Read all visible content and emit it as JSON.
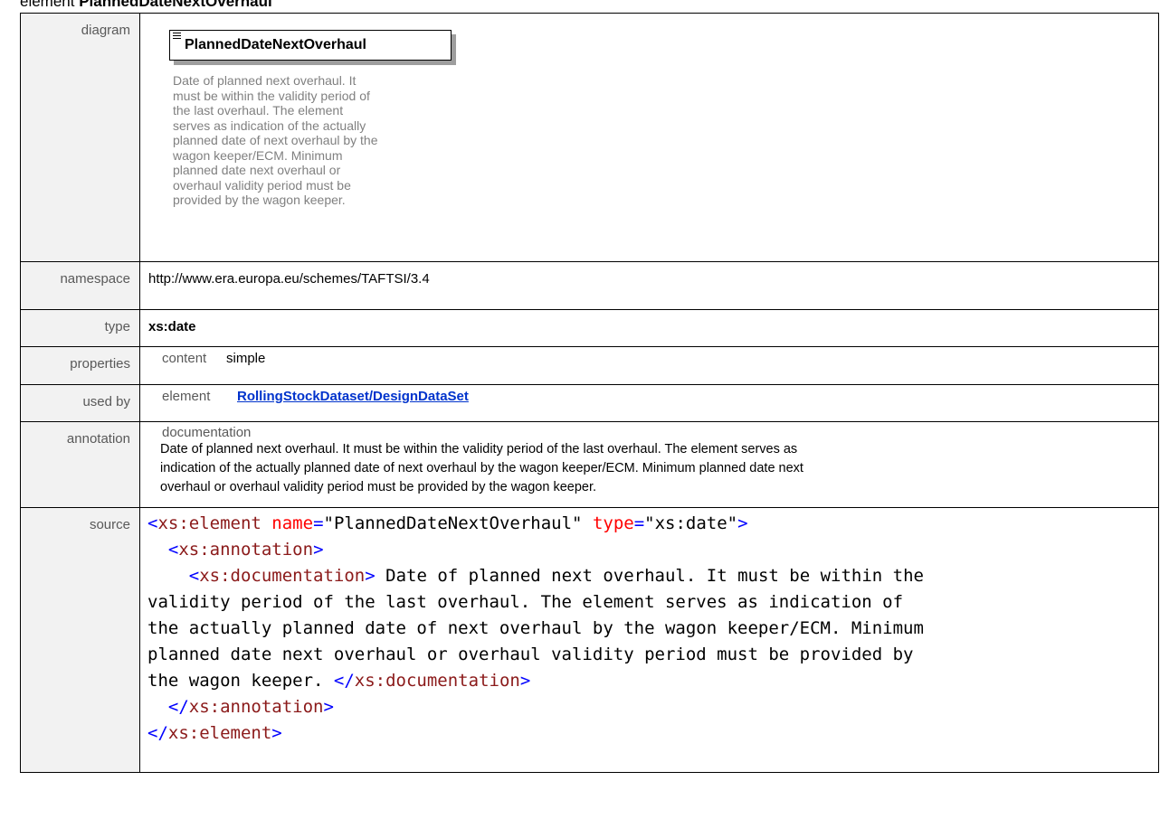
{
  "header": {
    "prefix": "element",
    "element_name": "PlannedDateNextOverhaul"
  },
  "rows": {
    "diagram": {
      "label": "diagram",
      "element_name": "PlannedDateNextOverhaul",
      "doc_lines": [
        "Date of planned next overhaul. It",
        "must be within the validity period of",
        "the last overhaul. The element",
        "serves as indication of the actually",
        "planned date of next overhaul by the",
        "wagon keeper/ECM. Minimum",
        "planned date next overhaul or",
        "overhaul validity period must be",
        "provided by the wagon keeper."
      ]
    },
    "namespace": {
      "label": "namespace",
      "value": "http://www.era.europa.eu/schemes/TAFTSI/3.4"
    },
    "type": {
      "label": "type",
      "value": "xs:date"
    },
    "properties": {
      "label": "properties",
      "key": "content",
      "value": "simple"
    },
    "used_by": {
      "label": "used by",
      "key": "element",
      "link": "RollingStockDataset/DesignDataSet"
    },
    "annotation": {
      "label": "annotation",
      "key": "documentation",
      "lines": [
        " Date of planned next overhaul. It must be within the validity period of the last overhaul. The element serves as",
        "indication of the actually planned date of next overhaul by the wagon keeper/ECM. Minimum planned date next",
        "overhaul or overhaul validity period must be provided by the wagon keeper."
      ]
    },
    "source": {
      "label": "source",
      "open_lt": "<",
      "element_tag": "xs:element",
      "name_attr": "name",
      "eq": "=",
      "name_val": "\"PlannedDateNextOverhaul\"",
      "type_attr": "type",
      "type_val": "\"xs:date\"",
      "gt": ">",
      "annotation_tag": "xs:annotation",
      "documentation_tag": "xs:documentation",
      "doc_text_1": " Date of planned next overhaul. It must be within the",
      "doc_text_2": "validity period of the last overhaul. The element serves as indication of",
      "doc_text_3": "the actually planned date of next overhaul by the wagon keeper/ECM. Minimum",
      "doc_text_4": "planned date next overhaul or overhaul validity period must be provided by",
      "doc_text_5": "the wagon keeper. ",
      "close_lt": "</"
    }
  }
}
